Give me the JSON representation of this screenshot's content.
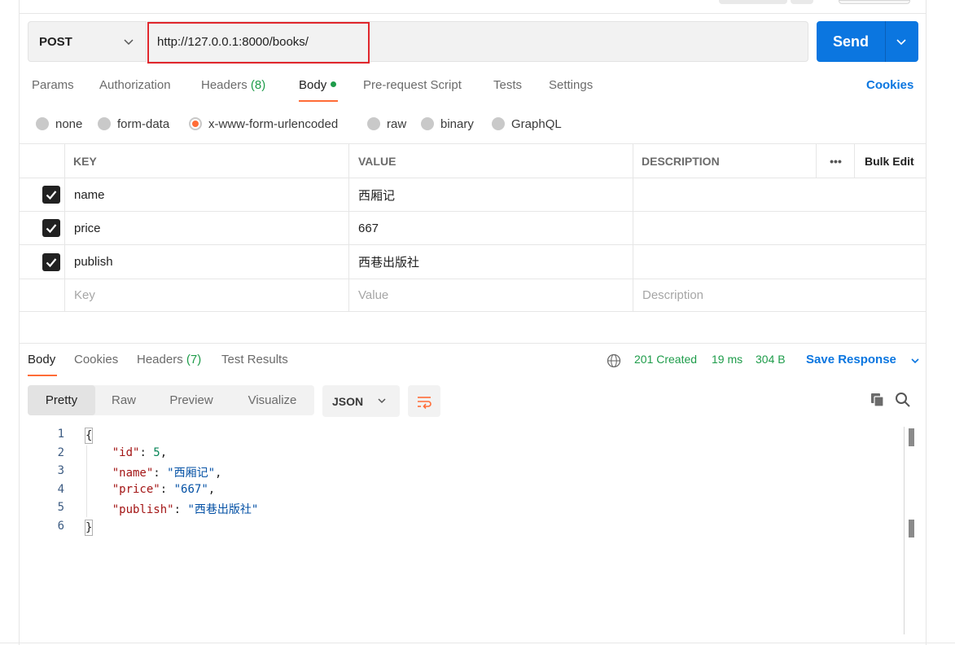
{
  "request": {
    "method": "POST",
    "url": "http://127.0.0.1:8000/books/",
    "send_label": "Send"
  },
  "request_tabs": [
    {
      "label": "Params",
      "count": ""
    },
    {
      "label": "Authorization",
      "count": ""
    },
    {
      "label": "Headers",
      "count": "(8)"
    },
    {
      "label": "Body",
      "count": ""
    },
    {
      "label": "Pre-request Script",
      "count": ""
    },
    {
      "label": "Tests",
      "count": ""
    },
    {
      "label": "Settings",
      "count": ""
    }
  ],
  "active_request_tab": "Body",
  "cookies_label": "Cookies",
  "body_types": [
    "none",
    "form-data",
    "x-www-form-urlencoded",
    "raw",
    "binary",
    "GraphQL"
  ],
  "selected_body_type": "x-www-form-urlencoded",
  "params_table": {
    "headers": {
      "key": "KEY",
      "value": "VALUE",
      "description": "DESCRIPTION",
      "more": "•••",
      "bulk_edit": "Bulk Edit"
    },
    "rows": [
      {
        "checked": true,
        "key": "name",
        "value": "西厢记",
        "description": ""
      },
      {
        "checked": true,
        "key": "price",
        "value": "667",
        "description": ""
      },
      {
        "checked": true,
        "key": "publish",
        "value": "西巷出版社",
        "description": ""
      }
    ],
    "placeholders": {
      "key": "Key",
      "value": "Value",
      "description": "Description"
    }
  },
  "response": {
    "tabs": [
      {
        "label": "Body",
        "count": ""
      },
      {
        "label": "Cookies",
        "count": ""
      },
      {
        "label": "Headers",
        "count": "(7)"
      },
      {
        "label": "Test Results",
        "count": ""
      }
    ],
    "active_tab": "Body",
    "status": "201 Created",
    "time": "19 ms",
    "size": "304 B",
    "save_label": "Save Response",
    "view_modes": [
      "Pretty",
      "Raw",
      "Preview",
      "Visualize"
    ],
    "active_view": "Pretty",
    "format": "JSON",
    "line_numbers": [
      "1",
      "2",
      "3",
      "4",
      "5",
      "6"
    ],
    "json_body": {
      "id": "5",
      "name": "西厢记",
      "price": "667",
      "publish": "西巷出版社"
    }
  },
  "colors": {
    "accent": "#ff6c37",
    "primary": "#0b76e0",
    "success": "#1e9c4a",
    "highlight_box": "#e0262c"
  }
}
